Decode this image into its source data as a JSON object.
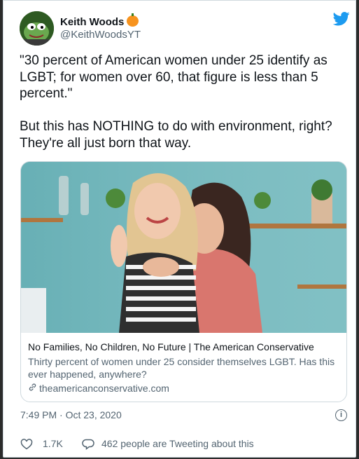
{
  "tweet": {
    "author_name": "Keith Woods",
    "author_handle": "@KeithWoodsYT",
    "text": "\"30 percent of American women under 25 identify as LGBT; for women over 60, that figure is less than 5 percent.\"\n\nBut this has NOTHING to do with environment, right? They're all just born that way.",
    "timestamp": "7:49 PM · Oct 23, 2020",
    "likes": "1.7K",
    "tweeting_about": "462 people are Tweeting about this"
  },
  "link_card": {
    "title": "No Families, No Children, No Future | The American Conservative",
    "description": "Thirty percent of women under 25 consider themselves LGBT. Has this ever happened, anywhere?",
    "domain": "theamericanconservative.com"
  },
  "colors": {
    "accent": "#1d9bf0",
    "text": "#0f1419",
    "secondary": "#536471"
  },
  "icons": [
    "twitter-bird-icon",
    "pumpkin-emoji-icon",
    "link-icon",
    "info-icon",
    "heart-icon",
    "reply-bubble-icon"
  ]
}
